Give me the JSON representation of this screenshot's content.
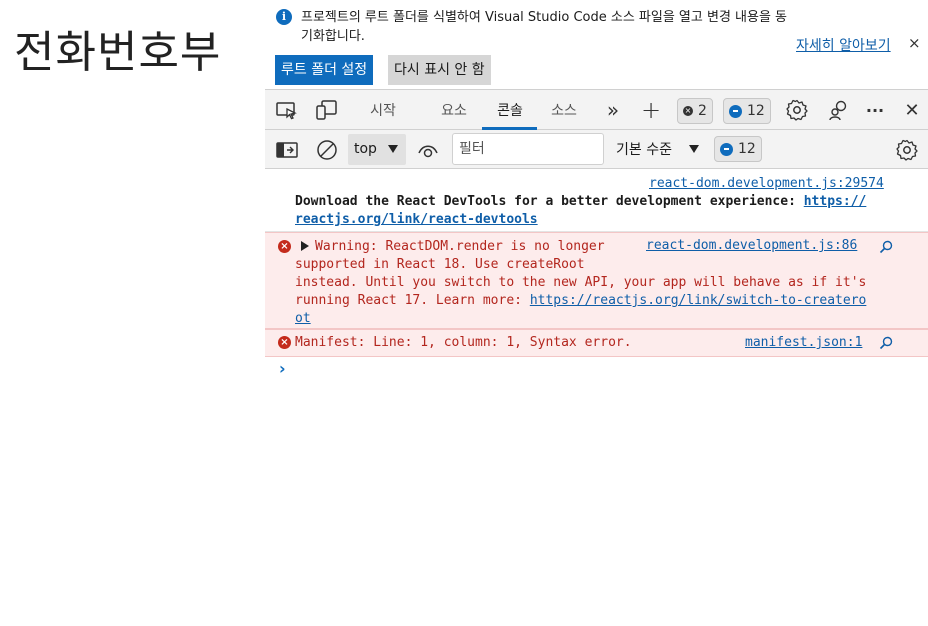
{
  "page": {
    "heading": "전화번호부"
  },
  "banner": {
    "message": "프로젝트의 루트 폴더를 식별하여 Visual Studio Code 소스 파일을 열고 변경 내용을 동기화합니다.",
    "learn_more": "자세히 알아보기",
    "primary_button": "루트 폴더 설정",
    "secondary_button": "다시 표시 안 함",
    "close": "×"
  },
  "toolbar": {
    "tabs": [
      {
        "label": "시작"
      },
      {
        "label": "요소"
      },
      {
        "label": "콘솔"
      },
      {
        "label": "소스"
      }
    ],
    "active_tab": "콘솔",
    "more_tabs": "»",
    "add": "+",
    "error_count": "2",
    "message_count": "12",
    "more": "···",
    "close": "✕"
  },
  "filterbar": {
    "context": "top",
    "filter_placeholder": "필터",
    "levels": "기본 수준",
    "message_count": "12"
  },
  "console": {
    "info": {
      "source": "react-dom.development.js:29574",
      "line1": "Download the React DevTools for a better development experience: ",
      "link1": "https://",
      "link2": "reactjs.org/link/react-devtools"
    },
    "warning": {
      "source": "react-dom.development.js:86",
      "line1": "Warning: ReactDOM.render is no longer",
      "line2": "supported in React 18. Use createRoot",
      "line3": "instead. Until you switch to the new API, your app will behave as if it's",
      "line4": "running React 17. Learn more: ",
      "link1": "https://reactjs.org/link/switch-to-createro",
      "link2": "ot"
    },
    "error": {
      "source": "manifest.json:1",
      "text": "Manifest: Line: 1, column: 1, Syntax error."
    },
    "prompt": "›"
  },
  "colors": {
    "accent": "#0f6cbd",
    "error_bg": "#fdecec",
    "error_text": "#b3261e"
  }
}
